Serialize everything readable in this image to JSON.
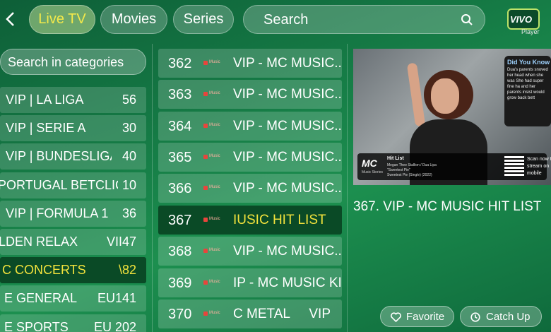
{
  "nav": {
    "back_icon": "chevron-left-icon",
    "tabs": [
      {
        "label": "Live TV",
        "active": true
      },
      {
        "label": "Movies",
        "active": false
      },
      {
        "label": "Series",
        "active": false
      }
    ],
    "search_placeholder": "Search",
    "search_icon": "search-icon",
    "logo_text": "VIVO",
    "logo_subtext": "Player"
  },
  "categories": {
    "search_placeholder": "Search in categories",
    "items": [
      {
        "name": "VIP | LA LIGA",
        "count": "56"
      },
      {
        "name": "VIP | SERIE A",
        "count": "30"
      },
      {
        "name": "VIP | BUNDESLIGA",
        "count": "40"
      },
      {
        "name": "PORTUGAL BETCLIC",
        "count": "10"
      },
      {
        "name": "VIP | FORMULA 1",
        "count": "36"
      },
      {
        "name": "LDEN RELAX",
        "count": "VII47"
      },
      {
        "name": "C CONCERTS",
        "count": "\\82",
        "selected": true
      },
      {
        "name": "E GENERAL",
        "count": "EU141"
      },
      {
        "name": "E SPORTS",
        "count": "EU 202"
      }
    ]
  },
  "channels": {
    "logo_text": "Music",
    "items": [
      {
        "number": "362",
        "name": "VIP - MC MUSIC..",
        "extra": ""
      },
      {
        "number": "363",
        "name": "VIP - MC MUSIC..",
        "extra": ""
      },
      {
        "number": "364",
        "name": "VIP - MC MUSIC..",
        "extra": ""
      },
      {
        "number": "365",
        "name": "VIP - MC MUSIC..",
        "extra": ""
      },
      {
        "number": "366",
        "name": "VIP - MC MUSIC..",
        "extra": ""
      },
      {
        "number": "367",
        "name": "IUSIC HIT LIST",
        "extra": "",
        "selected": true
      },
      {
        "number": "368",
        "name": "VIP - MC MUSIC..",
        "extra": ""
      },
      {
        "number": "369",
        "name": "IP - MC MUSIC KI",
        "extra": ""
      },
      {
        "number": "370",
        "name": "C METAL",
        "extra": "VIP"
      }
    ]
  },
  "preview": {
    "did_you_know_title": "Did You Know",
    "did_you_know_body": "Dua's parents snoved her head when she was She had super fine ha and her parents insist would grow back bett",
    "brand": "MC",
    "brand_sub": "Music Stories",
    "song_title": "Hit List",
    "song_artist": "Megan Thee Stallion / Dua Lipa",
    "song_name": "\"Sweetest Pie\"",
    "song_album": "Sweetest Pie (Single) (2022)",
    "scan_text": "Scan now to stream on mobile"
  },
  "selected_channel_title": "367.  VIP - MC MUSIC HIT LIST",
  "actions": {
    "favorite_label": "Favorite",
    "favorite_icon": "heart-icon",
    "catchup_label": "Catch Up",
    "catchup_icon": "clock-icon"
  }
}
